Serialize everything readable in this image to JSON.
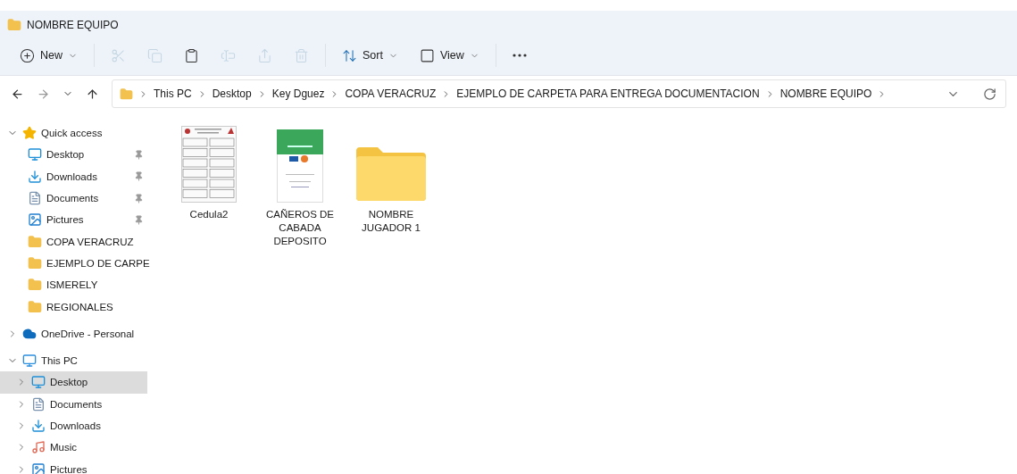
{
  "window": {
    "title": "NOMBRE EQUIPO"
  },
  "toolbar": [
    {
      "kind": "new",
      "label": "New",
      "disabled": false
    },
    {
      "kind": "cut",
      "disabled": true
    },
    {
      "kind": "copy",
      "disabled": true
    },
    {
      "kind": "paste",
      "disabled": false
    },
    {
      "kind": "rename",
      "disabled": true
    },
    {
      "kind": "share",
      "disabled": true
    },
    {
      "kind": "delete",
      "disabled": true
    },
    {
      "kind": "sort",
      "label": "Sort",
      "disabled": false
    },
    {
      "kind": "view",
      "label": "View",
      "disabled": false
    },
    {
      "kind": "more",
      "disabled": false
    }
  ],
  "address_bar": {
    "path": [
      "This PC",
      "Desktop",
      "Key Dguez",
      "COPA VERACRUZ",
      "EJEMPLO DE CARPETA PARA ENTREGA DOCUMENTACION",
      "NOMBRE EQUIPO"
    ]
  },
  "sidebar": {
    "items": [
      {
        "kind": "star",
        "label": "Quick access",
        "expanded": true,
        "selected": false,
        "children": [
          {
            "kind": "desktop",
            "label": "Desktop",
            "pinned": true,
            "selected": false
          },
          {
            "kind": "download",
            "label": "Downloads",
            "pinned": true,
            "selected": false
          },
          {
            "kind": "document",
            "label": "Documents",
            "pinned": true,
            "selected": false
          },
          {
            "kind": "picture",
            "label": "Pictures",
            "pinned": true,
            "selected": false
          },
          {
            "kind": "folder",
            "label": "COPA VERACRUZ",
            "pinned": false,
            "selected": false
          },
          {
            "kind": "folder",
            "label": "EJEMPLO DE CARPE",
            "pinned": false,
            "selected": false
          },
          {
            "kind": "folder",
            "label": "ISMERELY",
            "pinned": false,
            "selected": false
          },
          {
            "kind": "folder",
            "label": "REGIONALES",
            "pinned": false,
            "selected": false
          }
        ]
      },
      {
        "kind": "cloud",
        "label": "OneDrive - Personal",
        "expanded": false,
        "selected": false
      },
      {
        "kind": "pc",
        "label": "This PC",
        "expanded": true,
        "selected": false,
        "children": [
          {
            "kind": "desktop",
            "label": "Desktop",
            "expanded": false,
            "selected": true
          },
          {
            "kind": "document",
            "label": "Documents",
            "expanded": false,
            "selected": false
          },
          {
            "kind": "download",
            "label": "Downloads",
            "expanded": false,
            "selected": false
          },
          {
            "kind": "music",
            "label": "Music",
            "expanded": false,
            "selected": false
          },
          {
            "kind": "picture",
            "label": "Pictures",
            "expanded": false,
            "selected": false
          }
        ]
      }
    ]
  },
  "files": [
    {
      "kind": "form",
      "name": "Cedula2"
    },
    {
      "kind": "receipt",
      "name": "CAÑEROS DE CABADA DEPOSITO"
    },
    {
      "kind": "folder",
      "name": "NOMBRE JUGADOR 1"
    }
  ]
}
